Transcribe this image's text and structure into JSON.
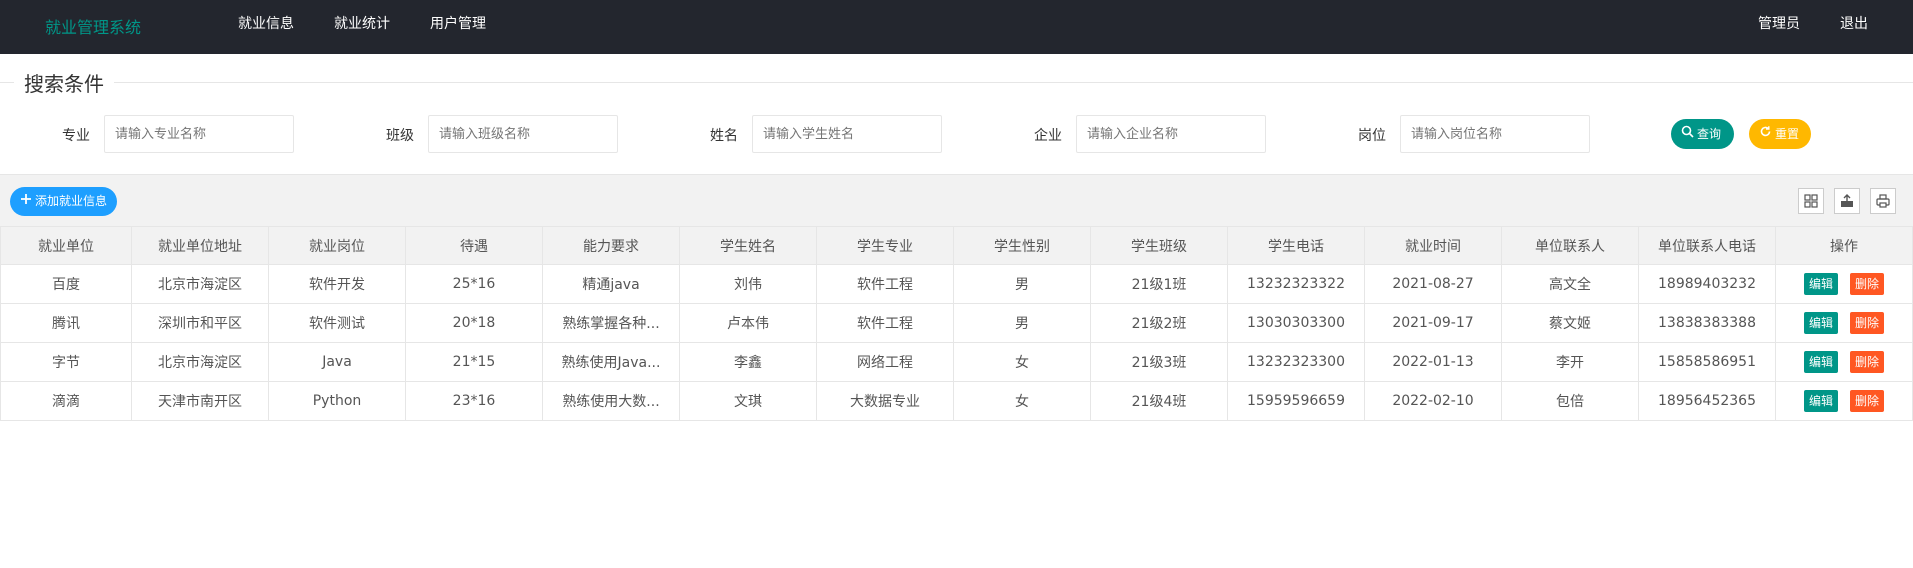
{
  "header": {
    "logo": "就业管理系统",
    "nav": [
      "就业信息",
      "就业统计",
      "用户管理"
    ],
    "user": "管理员",
    "logout": "退出"
  },
  "search": {
    "legend": "搜索条件",
    "fields": [
      {
        "label": "专业",
        "placeholder": "请输入专业名称"
      },
      {
        "label": "班级",
        "placeholder": "请输入班级名称"
      },
      {
        "label": "姓名",
        "placeholder": "请输入学生姓名"
      },
      {
        "label": "企业",
        "placeholder": "请输入企业名称"
      },
      {
        "label": "岗位",
        "placeholder": "请输入岗位名称"
      }
    ],
    "query_label": "查询",
    "reset_label": "重置"
  },
  "toolbar": {
    "add_label": "添加就业信息",
    "icons": [
      "columns-icon",
      "export-icon",
      "print-icon"
    ]
  },
  "table": {
    "columns": [
      "就业单位",
      "就业单位地址",
      "就业岗位",
      "待遇",
      "能力要求",
      "学生姓名",
      "学生专业",
      "学生性别",
      "学生班级",
      "学生电话",
      "就业时间",
      "单位联系人",
      "单位联系人电话",
      "操作"
    ],
    "edit_label": "编辑",
    "delete_label": "删除",
    "rows": [
      [
        "百度",
        "北京市海淀区",
        "软件开发",
        "25*16",
        "精通java",
        "刘伟",
        "软件工程",
        "男",
        "21级1班",
        "13232323322",
        "2021-08-27",
        "高文全",
        "18989403232"
      ],
      [
        "腾讯",
        "深圳市和平区",
        "软件测试",
        "20*18",
        "熟练掌握各种...",
        "卢本伟",
        "软件工程",
        "男",
        "21级2班",
        "13030303300",
        "2021-09-17",
        "蔡文姬",
        "13838383388"
      ],
      [
        "字节",
        "北京市海淀区",
        "Java",
        "21*15",
        "熟练使用Java...",
        "李鑫",
        "网络工程",
        "女",
        "21级3班",
        "13232323300",
        "2022-01-13",
        "李开",
        "15858586951"
      ],
      [
        "滴滴",
        "天津市南开区",
        "Python",
        "23*16",
        "熟练使用大数...",
        "文琪",
        "大数据专业",
        "女",
        "21级4班",
        "15959596659",
        "2022-02-10",
        "包倍",
        "18956452365"
      ]
    ]
  },
  "colors": {
    "header_bg": "#23262e",
    "accent": "#009688",
    "warn": "#ffb800",
    "primary": "#1e9fff",
    "danger": "#ff5722"
  }
}
